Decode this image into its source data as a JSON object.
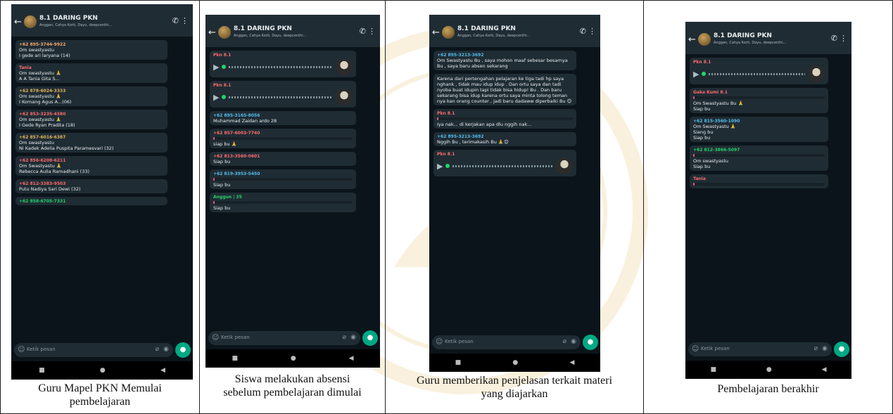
{
  "app": {
    "group_name": "8.1 DARING PKN",
    "group_members": "Anggan, Cahya Korti, Dayu, deepcenthi...",
    "input_placeholder": "Ketik pesan",
    "icons": [
      "back-arrow-icon",
      "group-avatar-icon",
      "call-icon",
      "menu-dots-icon",
      "emoji-icon",
      "attach-icon",
      "camera-icon",
      "mic-icon",
      "nav-square-icon",
      "nav-home-icon",
      "nav-back-icon"
    ]
  },
  "panels": [
    {
      "caption": "Guru Mapel PKN Memulai\npembelajaran",
      "messages": [
        {
          "sender": "+62 895-3744-9922",
          "text": "Om swastyastu\nI gede ari laryana (14)"
        },
        {
          "sender": "Tania",
          "text": "Om swastyastu 🙏\nA A Tania Gita S...",
          "c": "c2"
        },
        {
          "sender": "+62 878-6024-3333",
          "text": "Om swastyastu 🙏\nI Komang Agus A...(06)",
          "c": "c4"
        },
        {
          "sender": "+62 853-3235-4580",
          "text": "Om swastyastu 🙏\nI Gede Ryan Pradita (18)",
          "c": "c2"
        },
        {
          "sender": "+62 857-6016-6387",
          "text": "Om swastyastu\nNi Kadek Adelia Puspita Paramesvari (32)",
          "c": "c4"
        },
        {
          "sender": "+62 856-6208-6211",
          "text": "Om Swastyastu 🙏\nRebecca Aulia Ramadhani (33)",
          "c": "c2"
        },
        {
          "sender": "+62 812-3383-9503",
          "text": "Putu Nadiya Sari Dewi (32)",
          "c": "c2"
        },
        {
          "sender": "+62 858-6705-7331",
          "text": "",
          "c": "c3"
        }
      ]
    },
    {
      "caption": "Siswa melakukan absensi\nsebelum pembelajaran dimulai",
      "messages": [
        {
          "sender": "Pkn 8.1",
          "text": "",
          "voice": true,
          "c": "c2"
        },
        {
          "sender": "Pkn 8.1",
          "text": "",
          "voice": true,
          "c": "c2"
        },
        {
          "sender": "+62 895-3165-8056",
          "text": "Muhammad Zaidan ardo 28",
          "c": "c1"
        },
        {
          "sender": "+62 857-6003-7740",
          "text": "siap bu 🙏",
          "quote": true,
          "c": "c2"
        },
        {
          "sender": "+62 813-3560-0601",
          "text": "Siap bu",
          "c": "c2"
        },
        {
          "sender": "+62 819-3953-5450",
          "text": "Siap bu",
          "quote": true,
          "c": "c1"
        },
        {
          "sender": "Anggun | 35",
          "text": "Siap bu",
          "quote": true,
          "c": "c3"
        }
      ]
    },
    {
      "caption": "Guru memberikan penjelasan terkait materi\nyang diajarkan",
      "messages": [
        {
          "sender": "+62 895-3213-3692",
          "text": "Om Swastyastu Bu , saya mohon maaf sebesar besarnya Bu , saya baru absen sekarang",
          "c": "c1"
        },
        {
          "sender": "",
          "text": "Karena dari pertengahan pelajaran ke tiga tadi hp saya nghank , tidak mau idup idup . Dan ortu saya dan tadi nyoba buat idupin tapi tidak bisa hidup! Bu . Dan baru sekarang bisa idup karena ortu saya minta tolong teman nya kan orang counter , jadi baru dadaww diperbaiki Bu 😊",
          "c": "c1"
        },
        {
          "sender": "Pkn 8.1",
          "text": "Iya nak... di kerjakan apa dlu nggih nak...",
          "quote": true,
          "c": "c2"
        },
        {
          "sender": "+62 895-3213-3692",
          "text": "Nggih Bu , terimakasih Bu 🙏😊",
          "c": "c1"
        },
        {
          "sender": "Pkn 8.1",
          "text": "",
          "voice": true,
          "c": "c2"
        }
      ]
    },
    {
      "caption": "Pembelajaran berakhir",
      "messages": [
        {
          "sender": "Pkn 8.1",
          "text": "",
          "voice": true,
          "c": "c2"
        },
        {
          "sender": "Gaka Kumi 8.1",
          "text": "Om Swastyastu Bu 🙏\nSiap bu",
          "quote": true,
          "c": "c2"
        },
        {
          "sender": "+62 815-3560-1090",
          "text": "Om Swastyastu 🙏\nSiang bu\nSiap bu",
          "c": "c1"
        },
        {
          "sender": "+62 812-3866-5097",
          "text": "Om swastyastu\nSiap bu",
          "quote": true,
          "c": "c3"
        },
        {
          "sender": "Tania",
          "text": "",
          "quote": true,
          "c": "c2"
        }
      ]
    }
  ]
}
